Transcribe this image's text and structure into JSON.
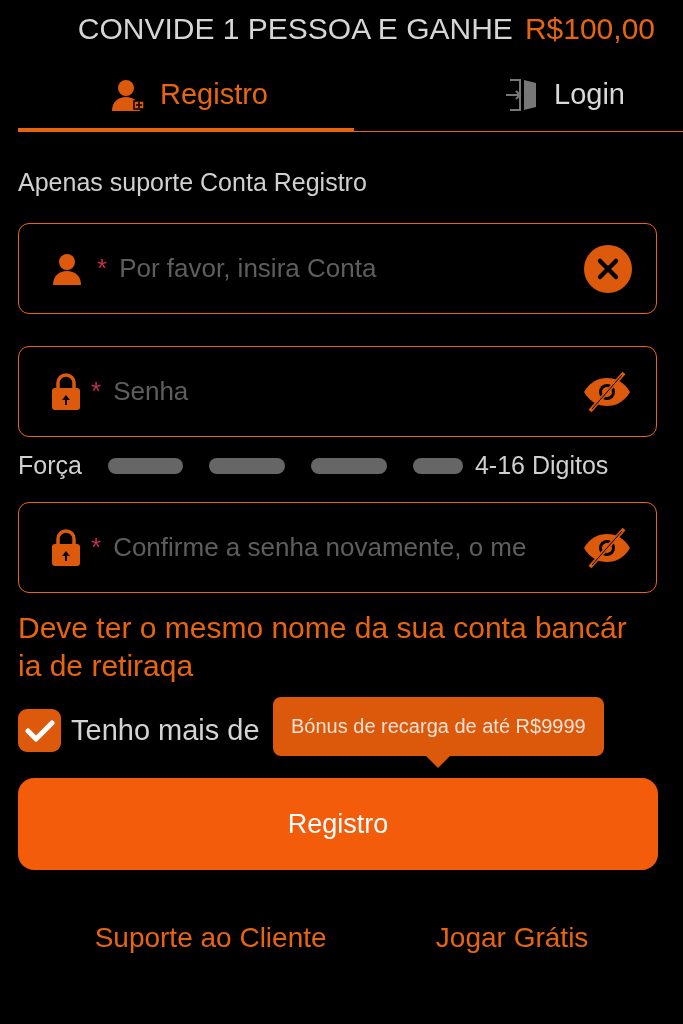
{
  "banner": {
    "text": "CONVIDE 1 PESSOA E GANHE",
    "amount": "R$100,00"
  },
  "tabs": [
    {
      "label": "Registro",
      "kind": "register",
      "selected": true
    },
    {
      "label": "Login",
      "kind": "login",
      "selected": false
    }
  ],
  "notice": "Apenas suporte Conta Registro",
  "fields": [
    {
      "kind": "account",
      "required": "*",
      "placeholder": "Por favor, insira Conta",
      "clearable": true
    },
    {
      "kind": "password",
      "required": "*",
      "placeholder": "Senha",
      "masked": true
    }
  ],
  "strength": {
    "label": "Força",
    "hint": "4-16 Digitos"
  },
  "confirm_field": {
    "kind": "password",
    "required": "*",
    "placeholder": "Confirme a senha novamente, o me",
    "masked": true
  },
  "warning": "Deve ter o mesmo nome da sua conta bancária de retiraqa",
  "agreement": {
    "checked": true,
    "label": "Tenho mais de"
  },
  "tooltip": "Bónus de recarga de até R$9999",
  "submit": "Registro",
  "footer_links": [
    "Suporte ao Cliente",
    "Jogar Grátis"
  ]
}
